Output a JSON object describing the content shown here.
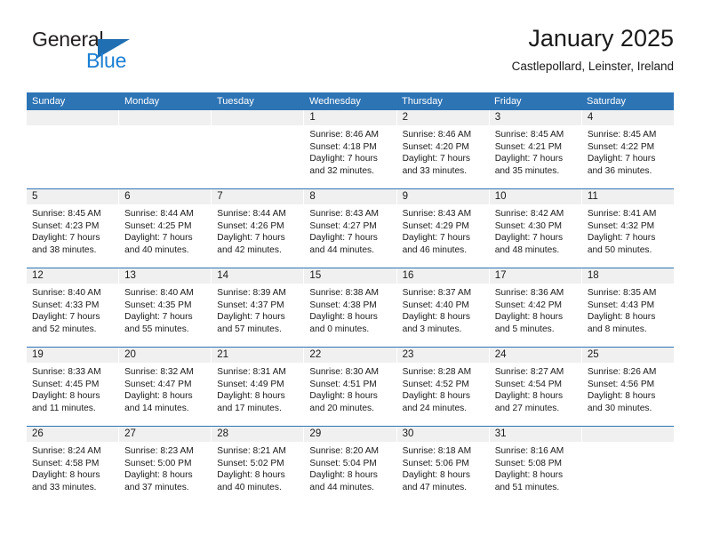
{
  "logo": {
    "word_one": "General",
    "word_two": "Blue",
    "triangle_color": "#1f6fb2",
    "blue_text_color": "#1b7fd4"
  },
  "header": {
    "title": "January 2025",
    "subtitle": "Castlepollard, Leinster, Ireland"
  },
  "theme": {
    "header_blue": "#2d74b5",
    "day_band_gray": "#f0f0f0",
    "text_color": "#1a1a1a"
  },
  "weekdays": [
    "Sunday",
    "Monday",
    "Tuesday",
    "Wednesday",
    "Thursday",
    "Friday",
    "Saturday"
  ],
  "weeks": [
    [
      {
        "day": "",
        "sunrise": "",
        "sunset": "",
        "daylight_line1": "",
        "daylight_line2": ""
      },
      {
        "day": "",
        "sunrise": "",
        "sunset": "",
        "daylight_line1": "",
        "daylight_line2": ""
      },
      {
        "day": "",
        "sunrise": "",
        "sunset": "",
        "daylight_line1": "",
        "daylight_line2": ""
      },
      {
        "day": "1",
        "sunrise": "Sunrise: 8:46 AM",
        "sunset": "Sunset: 4:18 PM",
        "daylight_line1": "Daylight: 7 hours",
        "daylight_line2": "and 32 minutes."
      },
      {
        "day": "2",
        "sunrise": "Sunrise: 8:46 AM",
        "sunset": "Sunset: 4:20 PM",
        "daylight_line1": "Daylight: 7 hours",
        "daylight_line2": "and 33 minutes."
      },
      {
        "day": "3",
        "sunrise": "Sunrise: 8:45 AM",
        "sunset": "Sunset: 4:21 PM",
        "daylight_line1": "Daylight: 7 hours",
        "daylight_line2": "and 35 minutes."
      },
      {
        "day": "4",
        "sunrise": "Sunrise: 8:45 AM",
        "sunset": "Sunset: 4:22 PM",
        "daylight_line1": "Daylight: 7 hours",
        "daylight_line2": "and 36 minutes."
      }
    ],
    [
      {
        "day": "5",
        "sunrise": "Sunrise: 8:45 AM",
        "sunset": "Sunset: 4:23 PM",
        "daylight_line1": "Daylight: 7 hours",
        "daylight_line2": "and 38 minutes."
      },
      {
        "day": "6",
        "sunrise": "Sunrise: 8:44 AM",
        "sunset": "Sunset: 4:25 PM",
        "daylight_line1": "Daylight: 7 hours",
        "daylight_line2": "and 40 minutes."
      },
      {
        "day": "7",
        "sunrise": "Sunrise: 8:44 AM",
        "sunset": "Sunset: 4:26 PM",
        "daylight_line1": "Daylight: 7 hours",
        "daylight_line2": "and 42 minutes."
      },
      {
        "day": "8",
        "sunrise": "Sunrise: 8:43 AM",
        "sunset": "Sunset: 4:27 PM",
        "daylight_line1": "Daylight: 7 hours",
        "daylight_line2": "and 44 minutes."
      },
      {
        "day": "9",
        "sunrise": "Sunrise: 8:43 AM",
        "sunset": "Sunset: 4:29 PM",
        "daylight_line1": "Daylight: 7 hours",
        "daylight_line2": "and 46 minutes."
      },
      {
        "day": "10",
        "sunrise": "Sunrise: 8:42 AM",
        "sunset": "Sunset: 4:30 PM",
        "daylight_line1": "Daylight: 7 hours",
        "daylight_line2": "and 48 minutes."
      },
      {
        "day": "11",
        "sunrise": "Sunrise: 8:41 AM",
        "sunset": "Sunset: 4:32 PM",
        "daylight_line1": "Daylight: 7 hours",
        "daylight_line2": "and 50 minutes."
      }
    ],
    [
      {
        "day": "12",
        "sunrise": "Sunrise: 8:40 AM",
        "sunset": "Sunset: 4:33 PM",
        "daylight_line1": "Daylight: 7 hours",
        "daylight_line2": "and 52 minutes."
      },
      {
        "day": "13",
        "sunrise": "Sunrise: 8:40 AM",
        "sunset": "Sunset: 4:35 PM",
        "daylight_line1": "Daylight: 7 hours",
        "daylight_line2": "and 55 minutes."
      },
      {
        "day": "14",
        "sunrise": "Sunrise: 8:39 AM",
        "sunset": "Sunset: 4:37 PM",
        "daylight_line1": "Daylight: 7 hours",
        "daylight_line2": "and 57 minutes."
      },
      {
        "day": "15",
        "sunrise": "Sunrise: 8:38 AM",
        "sunset": "Sunset: 4:38 PM",
        "daylight_line1": "Daylight: 8 hours",
        "daylight_line2": "and 0 minutes."
      },
      {
        "day": "16",
        "sunrise": "Sunrise: 8:37 AM",
        "sunset": "Sunset: 4:40 PM",
        "daylight_line1": "Daylight: 8 hours",
        "daylight_line2": "and 3 minutes."
      },
      {
        "day": "17",
        "sunrise": "Sunrise: 8:36 AM",
        "sunset": "Sunset: 4:42 PM",
        "daylight_line1": "Daylight: 8 hours",
        "daylight_line2": "and 5 minutes."
      },
      {
        "day": "18",
        "sunrise": "Sunrise: 8:35 AM",
        "sunset": "Sunset: 4:43 PM",
        "daylight_line1": "Daylight: 8 hours",
        "daylight_line2": "and 8 minutes."
      }
    ],
    [
      {
        "day": "19",
        "sunrise": "Sunrise: 8:33 AM",
        "sunset": "Sunset: 4:45 PM",
        "daylight_line1": "Daylight: 8 hours",
        "daylight_line2": "and 11 minutes."
      },
      {
        "day": "20",
        "sunrise": "Sunrise: 8:32 AM",
        "sunset": "Sunset: 4:47 PM",
        "daylight_line1": "Daylight: 8 hours",
        "daylight_line2": "and 14 minutes."
      },
      {
        "day": "21",
        "sunrise": "Sunrise: 8:31 AM",
        "sunset": "Sunset: 4:49 PM",
        "daylight_line1": "Daylight: 8 hours",
        "daylight_line2": "and 17 minutes."
      },
      {
        "day": "22",
        "sunrise": "Sunrise: 8:30 AM",
        "sunset": "Sunset: 4:51 PM",
        "daylight_line1": "Daylight: 8 hours",
        "daylight_line2": "and 20 minutes."
      },
      {
        "day": "23",
        "sunrise": "Sunrise: 8:28 AM",
        "sunset": "Sunset: 4:52 PM",
        "daylight_line1": "Daylight: 8 hours",
        "daylight_line2": "and 24 minutes."
      },
      {
        "day": "24",
        "sunrise": "Sunrise: 8:27 AM",
        "sunset": "Sunset: 4:54 PM",
        "daylight_line1": "Daylight: 8 hours",
        "daylight_line2": "and 27 minutes."
      },
      {
        "day": "25",
        "sunrise": "Sunrise: 8:26 AM",
        "sunset": "Sunset: 4:56 PM",
        "daylight_line1": "Daylight: 8 hours",
        "daylight_line2": "and 30 minutes."
      }
    ],
    [
      {
        "day": "26",
        "sunrise": "Sunrise: 8:24 AM",
        "sunset": "Sunset: 4:58 PM",
        "daylight_line1": "Daylight: 8 hours",
        "daylight_line2": "and 33 minutes."
      },
      {
        "day": "27",
        "sunrise": "Sunrise: 8:23 AM",
        "sunset": "Sunset: 5:00 PM",
        "daylight_line1": "Daylight: 8 hours",
        "daylight_line2": "and 37 minutes."
      },
      {
        "day": "28",
        "sunrise": "Sunrise: 8:21 AM",
        "sunset": "Sunset: 5:02 PM",
        "daylight_line1": "Daylight: 8 hours",
        "daylight_line2": "and 40 minutes."
      },
      {
        "day": "29",
        "sunrise": "Sunrise: 8:20 AM",
        "sunset": "Sunset: 5:04 PM",
        "daylight_line1": "Daylight: 8 hours",
        "daylight_line2": "and 44 minutes."
      },
      {
        "day": "30",
        "sunrise": "Sunrise: 8:18 AM",
        "sunset": "Sunset: 5:06 PM",
        "daylight_line1": "Daylight: 8 hours",
        "daylight_line2": "and 47 minutes."
      },
      {
        "day": "31",
        "sunrise": "Sunrise: 8:16 AM",
        "sunset": "Sunset: 5:08 PM",
        "daylight_line1": "Daylight: 8 hours",
        "daylight_line2": "and 51 minutes."
      },
      {
        "day": "",
        "sunrise": "",
        "sunset": "",
        "daylight_line1": "",
        "daylight_line2": ""
      }
    ]
  ]
}
